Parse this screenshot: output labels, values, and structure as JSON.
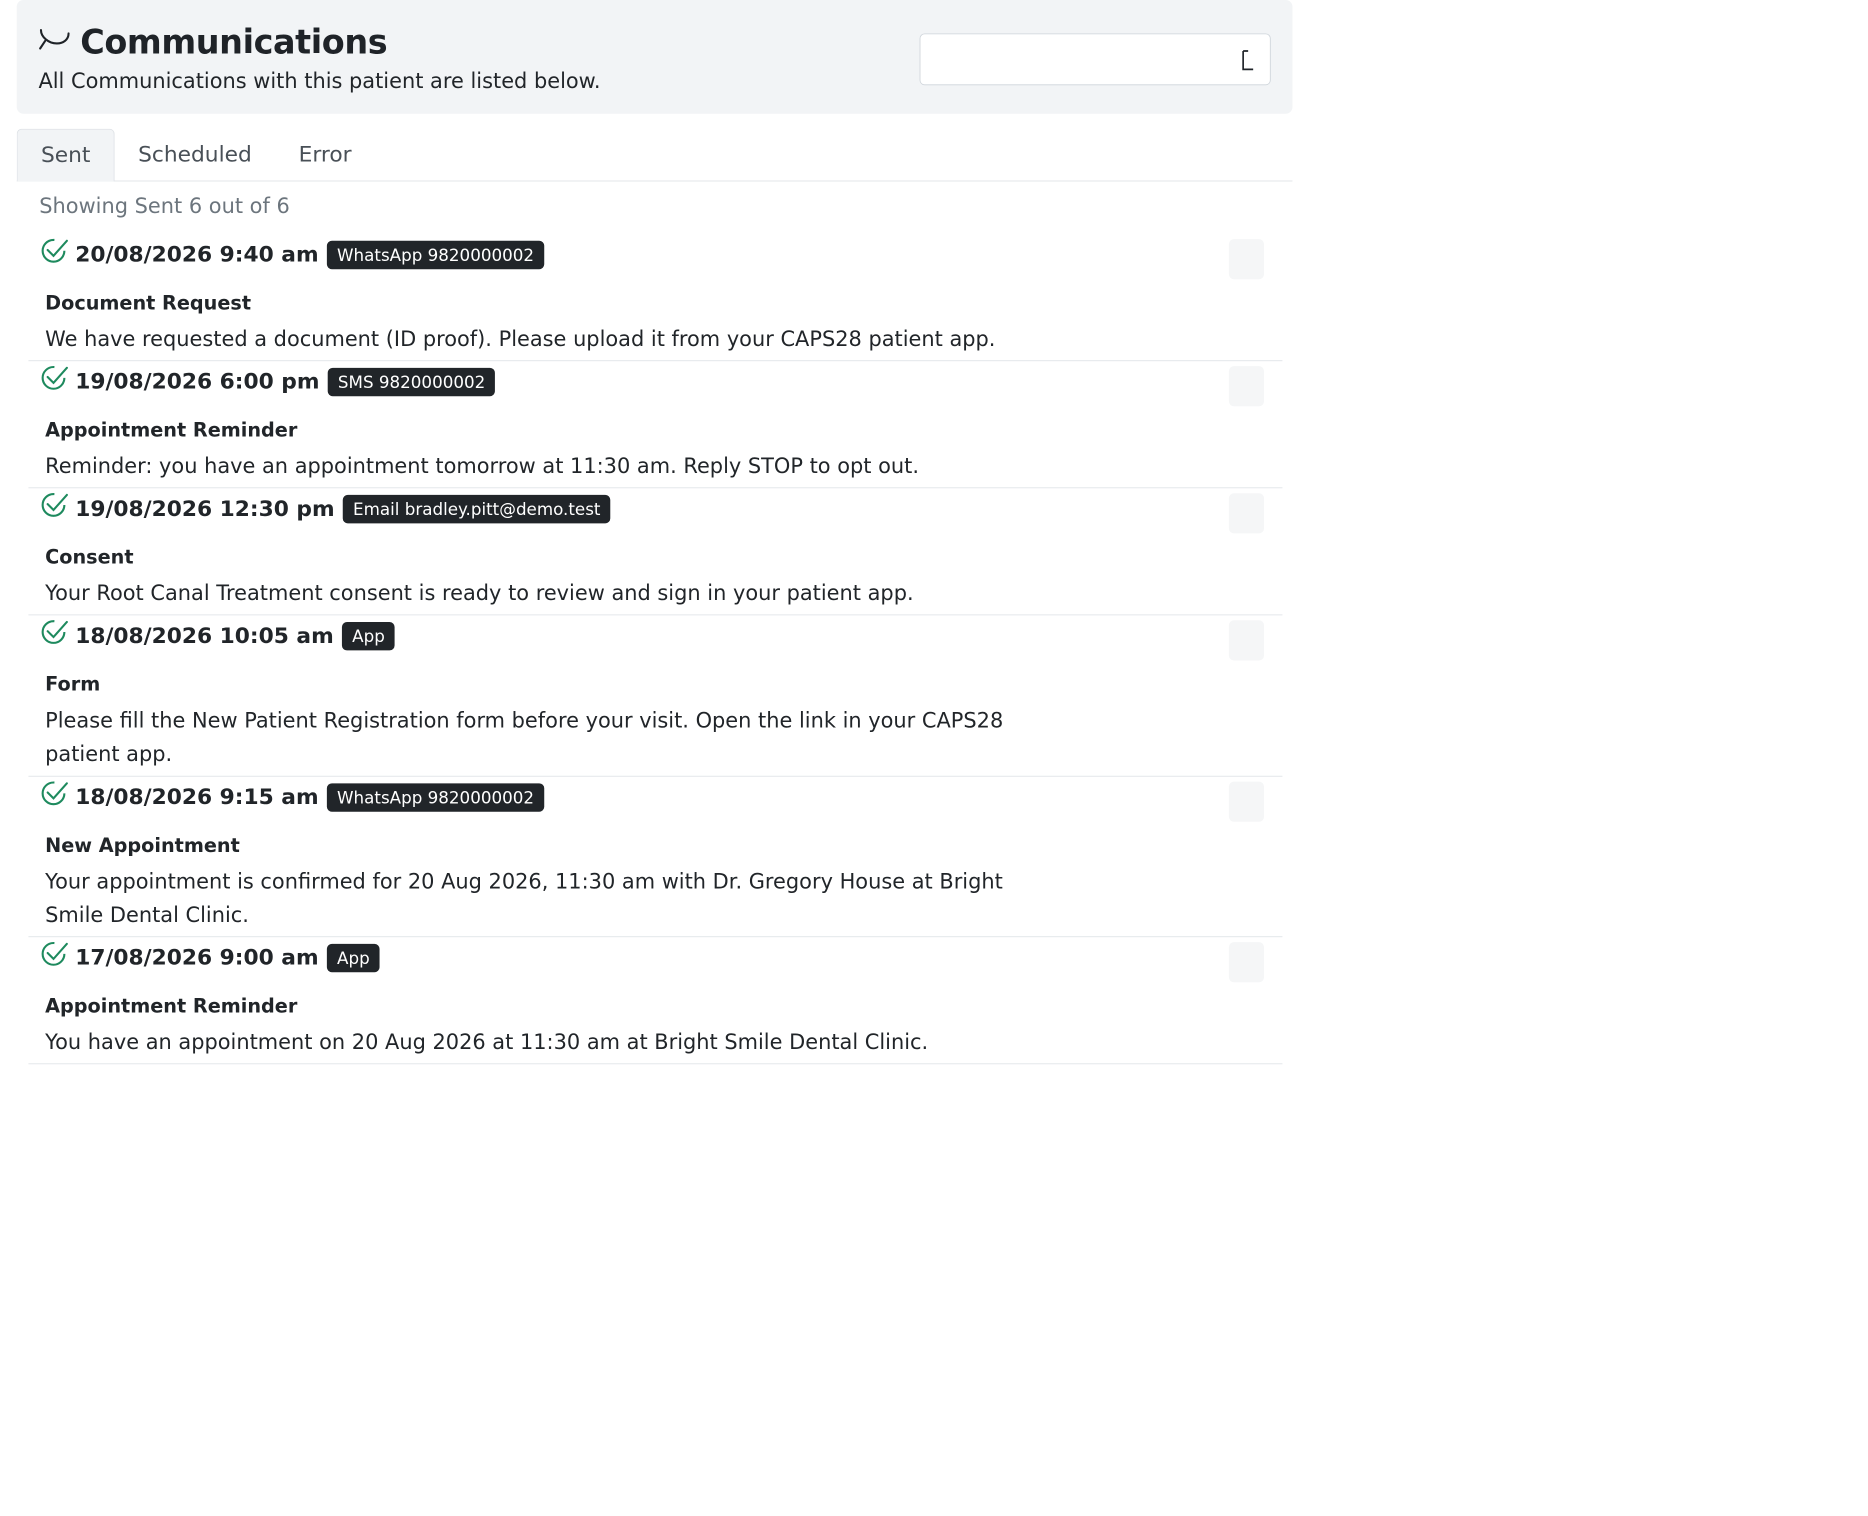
{
  "header": {
    "title": "Communications",
    "subtitle": "All Communications with this patient are listed below.",
    "search_value": ""
  },
  "tabs": [
    {
      "label": "Sent",
      "active": true
    },
    {
      "label": "Scheduled",
      "active": false
    },
    {
      "label": "Error",
      "active": false
    }
  ],
  "showing_text": "Showing Sent 6 out of 6",
  "colors": {
    "check": "#1e8a5e",
    "badge_bg": "#212529",
    "header_bg": "#f2f4f6"
  },
  "communications": [
    {
      "datetime": "20/08/2026 9:40 am",
      "channel": "WhatsApp 9820000002",
      "label": "Document Request",
      "message": "We have requested a document (ID proof). Please upload it from your CAPS28 patient app.",
      "status_icon": "double-check-icon"
    },
    {
      "datetime": "19/08/2026 6:00 pm",
      "channel": "SMS 9820000002",
      "label": "Appointment Reminder",
      "message": "Reminder: you have an appointment tomorrow at 11:30 am. Reply STOP to opt out.",
      "status_icon": "double-check-icon"
    },
    {
      "datetime": "19/08/2026 12:30 pm",
      "channel": "Email bradley.pitt@demo.test",
      "label": "Consent",
      "message": "Your Root Canal Treatment consent is ready to review and sign in your patient app.",
      "status_icon": "double-check-icon"
    },
    {
      "datetime": "18/08/2026 10:05 am",
      "channel": "App",
      "label": "Form",
      "message": "Please fill the New Patient Registration form before your visit. Open the link in your CAPS28 patient app.",
      "status_icon": "double-check-icon"
    },
    {
      "datetime": "18/08/2026 9:15 am",
      "channel": "WhatsApp 9820000002",
      "label": "New Appointment",
      "message": "Your appointment is confirmed for 20 Aug 2026, 11:30 am with Dr. Gregory House at Bright Smile Dental Clinic.",
      "status_icon": "double-check-icon"
    },
    {
      "datetime": "17/08/2026 9:00 am",
      "channel": "App",
      "label": "Appointment Reminder",
      "message": "You have an appointment on 20 Aug 2026 at 11:30 am at Bright Smile Dental Clinic.",
      "status_icon": "double-check-icon"
    }
  ]
}
